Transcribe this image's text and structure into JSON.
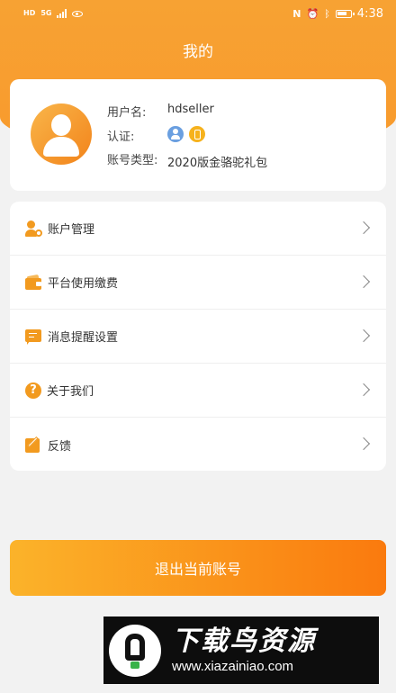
{
  "status_bar": {
    "left_chips": [
      "HD",
      "5G"
    ],
    "right_icons": [
      "nfc-icon",
      "alarm-icon",
      "bluetooth-icon",
      "battery-icon"
    ],
    "time": "4:38"
  },
  "header": {
    "title": "我的",
    "background_color": "#f7a233"
  },
  "profile": {
    "username_label": "用户名:",
    "username_value": "hdseller",
    "cert_label": "认证:",
    "cert_badges": [
      "person-verified-icon",
      "phone-verified-icon"
    ],
    "account_type_label": "账号类型:",
    "account_type_value": "2020版金骆驼礼包"
  },
  "menu": {
    "items": [
      {
        "label": "账户管理",
        "icon": "account-manage-icon"
      },
      {
        "label": "平台使用缴费",
        "icon": "wallet-icon"
      },
      {
        "label": "消息提醒设置",
        "icon": "message-icon"
      },
      {
        "label": "关于我们",
        "icon": "help-icon"
      },
      {
        "label": "反馈",
        "icon": "feedback-icon"
      }
    ]
  },
  "logout_button": {
    "label": "退出当前账号",
    "gradient": [
      "#fbb32a",
      "#fa7a0e"
    ]
  },
  "watermark": {
    "title": "下载鸟资源",
    "url": "www.xiazainiao.com"
  }
}
